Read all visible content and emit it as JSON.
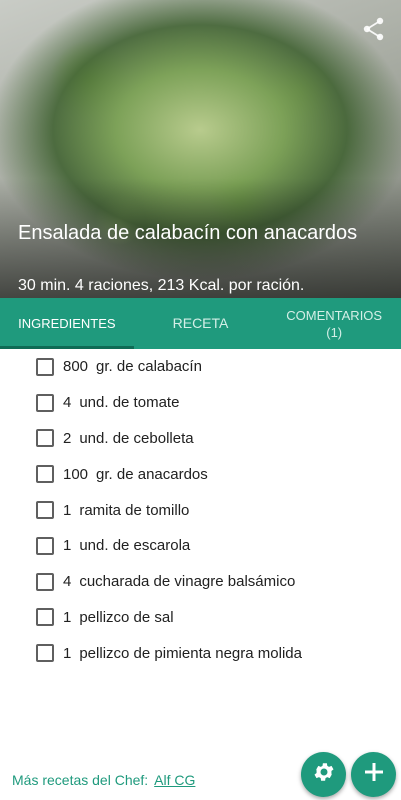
{
  "recipe": {
    "title": "Ensalada de calabacín con anacardos",
    "subtitle": "30 min. 4 raciones, 213 Kcal. por ración."
  },
  "icons": {
    "share": "share-icon",
    "settings": "gear-icon",
    "add": "plus-icon"
  },
  "tabs": [
    {
      "label": "INGREDIENTES",
      "active": true
    },
    {
      "label": "RECETA",
      "active": false
    },
    {
      "label": "COMENTARIOS\n(1)",
      "active": false
    }
  ],
  "ingredients": [
    {
      "qty": "800",
      "unit": "gr. de calabacín"
    },
    {
      "qty": "4",
      "unit": "und. de tomate"
    },
    {
      "qty": "2",
      "unit": "und. de cebolleta"
    },
    {
      "qty": "100",
      "unit": "gr. de anacardos"
    },
    {
      "qty": "1",
      "unit": "ramita de tomillo"
    },
    {
      "qty": "1",
      "unit": "und. de escarola"
    },
    {
      "qty": "4",
      "unit": "cucharada de vinagre balsámico"
    },
    {
      "qty": "1",
      "unit": "pellizco de sal"
    },
    {
      "qty": "1",
      "unit": "pellizco de pimienta negra molida"
    }
  ],
  "footer": {
    "label": "Más recetas del Chef:",
    "chef": "Alf CG"
  },
  "colors": {
    "accent": "#1f9a7d",
    "tab_indicator": "#0e6b55"
  }
}
